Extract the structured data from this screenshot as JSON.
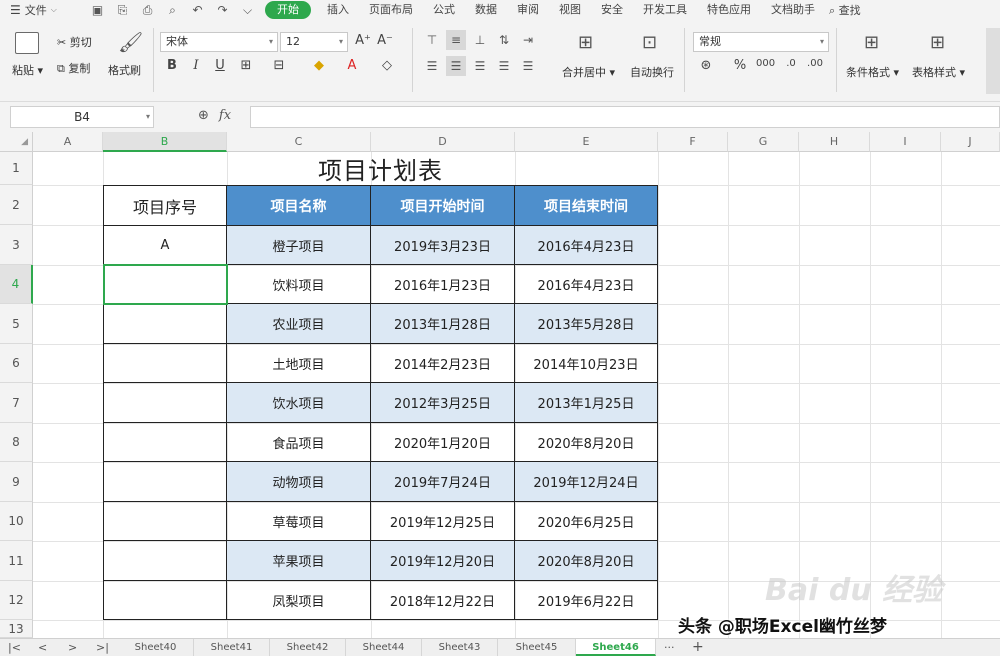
{
  "menubar": {
    "file_label": "文件",
    "tabs": [
      "开始",
      "插入",
      "页面布局",
      "公式",
      "数据",
      "审阅",
      "视图",
      "安全",
      "开发工具",
      "特色应用",
      "文档助手"
    ],
    "search_label": "查找"
  },
  "ribbon": {
    "paste": "粘贴",
    "cut": "剪切",
    "copy": "复制",
    "format_painter": "格式刷",
    "font_name": "宋体",
    "font_size": "12",
    "merge_center": "合并居中",
    "wrap_text": "自动换行",
    "number_format": "常规",
    "cond_format": "条件格式",
    "table_style": "表格样式"
  },
  "formula_bar": {
    "name_box": "B4",
    "fx": "fx",
    "value": ""
  },
  "grid": {
    "columns": [
      "A",
      "B",
      "C",
      "D",
      "E",
      "F",
      "G",
      "H",
      "I",
      "J"
    ],
    "rows": [
      "1",
      "2",
      "3",
      "4",
      "5",
      "6",
      "7",
      "8",
      "9",
      "10",
      "11",
      "12",
      "13"
    ],
    "selected_cell": "B4"
  },
  "table": {
    "title": "项目计划表",
    "headers": [
      "项目序号",
      "项目名称",
      "项目开始时间",
      "项目结束时间"
    ],
    "rows": [
      [
        "A",
        "橙子项目",
        "2019年3月23日",
        "2016年4月23日"
      ],
      [
        "",
        "饮料项目",
        "2016年1月23日",
        "2016年4月23日"
      ],
      [
        "",
        "农业项目",
        "2013年1月28日",
        "2013年5月28日"
      ],
      [
        "",
        "土地项目",
        "2014年2月23日",
        "2014年10月23日"
      ],
      [
        "",
        "饮水项目",
        "2012年3月25日",
        "2013年1月25日"
      ],
      [
        "",
        "食品项目",
        "2020年1月20日",
        "2020年8月20日"
      ],
      [
        "",
        "动物项目",
        "2019年7月24日",
        "2019年12月24日"
      ],
      [
        "",
        "草莓项目",
        "2019年12月25日",
        "2020年6月25日"
      ],
      [
        "",
        "苹果项目",
        "2019年12月20日",
        "2020年8月20日"
      ],
      [
        "",
        "凤梨项目",
        "2018年12月22日",
        "2019年6月22日"
      ]
    ]
  },
  "sheets": {
    "tabs": [
      "Sheet40",
      "Sheet41",
      "Sheet42",
      "Sheet44",
      "Sheet43",
      "Sheet45",
      "Sheet46"
    ],
    "active": "Sheet46",
    "more": "···",
    "add": "+"
  },
  "watermarks": {
    "baidu": "Bai du 经验",
    "author": "头条 @职场Excel幽竹丝梦"
  },
  "colors": {
    "accent": "#2ea84d",
    "header_blue": "#4e8fcc",
    "band_blue": "#dce8f4"
  }
}
